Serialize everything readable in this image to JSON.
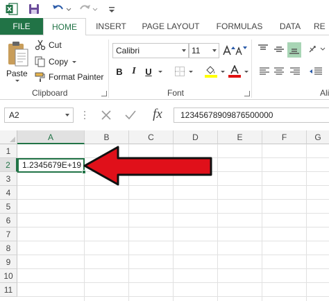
{
  "colors": {
    "accent": "#217346",
    "arrow": "#e0101a"
  },
  "tabs": [
    {
      "label": "FILE"
    },
    {
      "label": "HOME"
    },
    {
      "label": "INSERT"
    },
    {
      "label": "PAGE LAYOUT"
    },
    {
      "label": "FORMULAS"
    },
    {
      "label": "DATA"
    },
    {
      "label": "RE"
    }
  ],
  "clipboard": {
    "paste_label": "Paste",
    "cut_label": "Cut",
    "copy_label": "Copy",
    "format_painter_label": "Format Painter",
    "group_label": "Clipboard"
  },
  "font": {
    "name": "Calibri",
    "size": "11",
    "bold_label": "B",
    "italic_label": "I",
    "underline_label": "U",
    "group_label": "Font"
  },
  "alignment": {
    "group_label": "Ali"
  },
  "formula_bar": {
    "name_box": "A2",
    "fx_label": "fx",
    "formula_value": "12345678909876500000"
  },
  "grid": {
    "columns": [
      "A",
      "B",
      "C",
      "D",
      "E",
      "F",
      "G"
    ],
    "rows": [
      "1",
      "2",
      "3",
      "4",
      "5",
      "6",
      "7",
      "8",
      "9",
      "10",
      "11"
    ],
    "selected_cell": {
      "ref": "A2",
      "display_value": "1.2345679E+19"
    }
  }
}
